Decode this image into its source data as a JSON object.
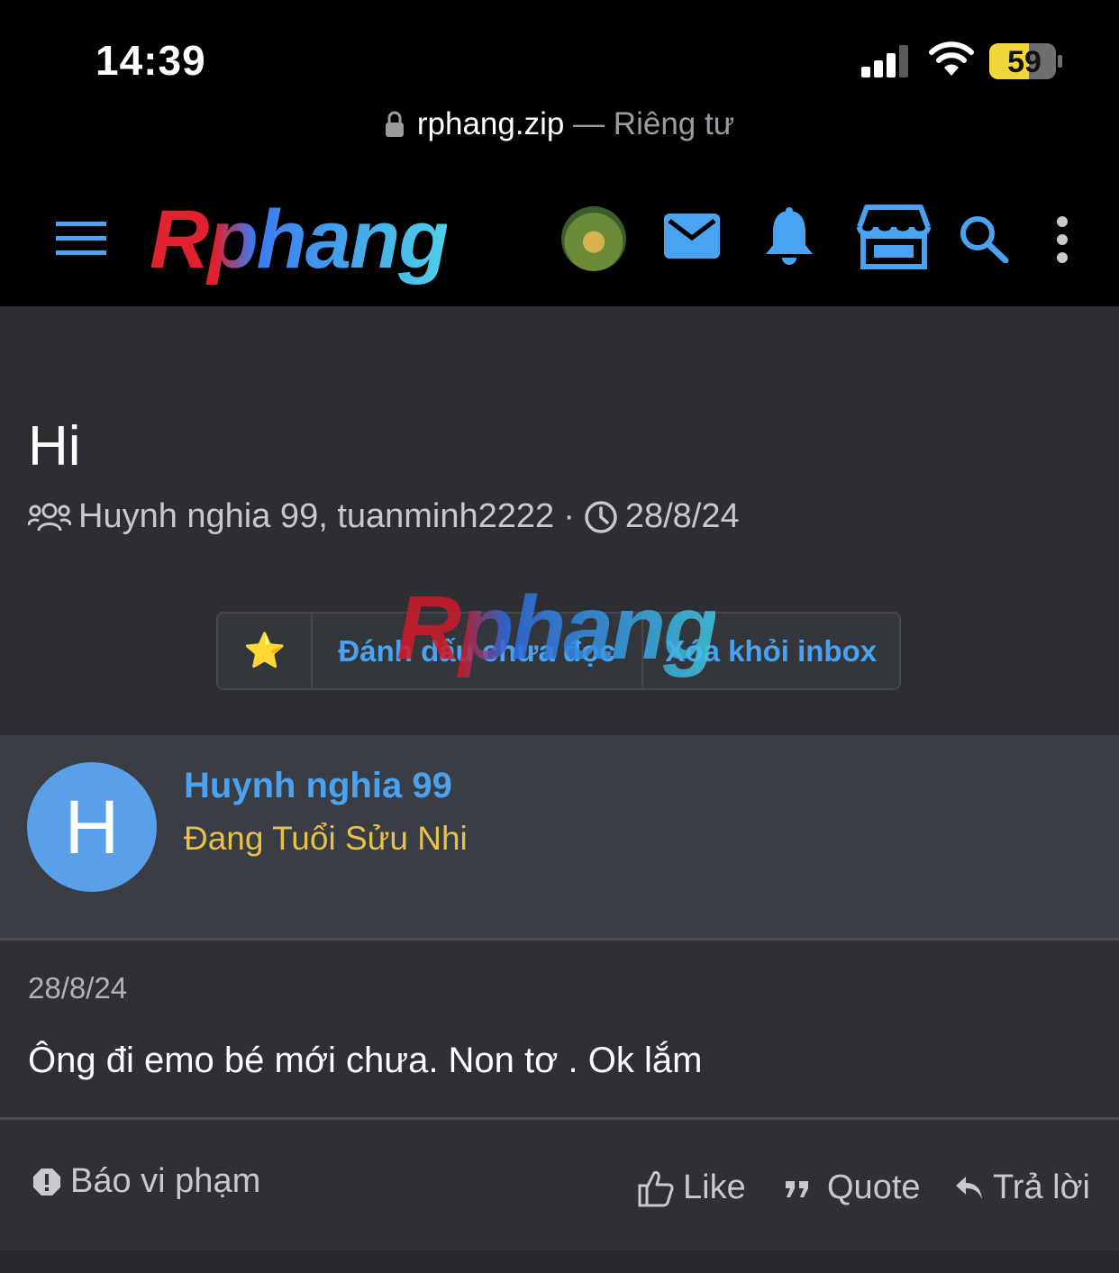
{
  "status_bar": {
    "time": "14:39",
    "battery_level": "59",
    "signal_icon": "cellular-signal-icon",
    "wifi_icon": "wifi-icon",
    "battery_icon": "battery-icon"
  },
  "browser": {
    "domain": "rphang.zip",
    "separator": "—",
    "privacy_label": "Riêng tư"
  },
  "navbar": {
    "logo_text": "Rphang",
    "icons": [
      "menu-icon",
      "user-avatar",
      "mail-icon",
      "bell-icon",
      "store-icon",
      "search-icon",
      "more-vertical-icon"
    ]
  },
  "conversation": {
    "title": "Hi",
    "participants": "Huynh nghia 99, tuanminh2222",
    "dot": "·",
    "date": "28/8/24",
    "actions": {
      "star_label": "⭐",
      "mark_unread": "Đánh dấu chưa đọc",
      "remove_inbox": "Xóa khỏi inbox"
    },
    "watermark": "Rphang"
  },
  "message": {
    "avatar_letter": "H",
    "username": "Huynh nghia 99",
    "user_title": "Đang Tuổi Sửu Nhi",
    "date": "28/8/24",
    "text": "Ông đi emo bé mới chưa. Non tơ . Ok lắm",
    "report_label": "Báo vi phạm",
    "like_label": "Like",
    "quote_label": "Quote",
    "reply_label": "Trả lời"
  },
  "colors": {
    "accent_blue": "#4aa3f0",
    "title_yellow": "#e8c14a",
    "avatar_blue": "#5aa0e8",
    "background": "#2c2e33"
  }
}
